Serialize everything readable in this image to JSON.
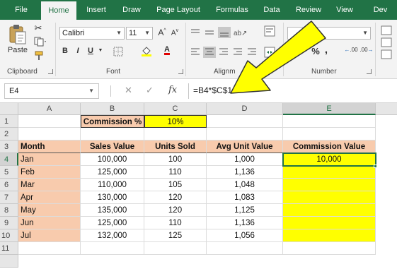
{
  "ribbon": {
    "tabs": [
      {
        "label": "File",
        "active": false
      },
      {
        "label": "Home",
        "active": true
      },
      {
        "label": "Insert",
        "active": false
      },
      {
        "label": "Draw",
        "active": false
      },
      {
        "label": "Page Layout",
        "active": false
      },
      {
        "label": "Formulas",
        "active": false
      },
      {
        "label": "Data",
        "active": false
      },
      {
        "label": "Review",
        "active": false
      },
      {
        "label": "View",
        "active": false
      },
      {
        "label": "Dev",
        "active": false
      }
    ],
    "clipboard": {
      "paste_label": "Paste",
      "group_label": "Clipboard"
    },
    "font": {
      "name": "Calibri",
      "size": "11",
      "bold": "B",
      "italic": "I",
      "underline": "U",
      "grow": "A",
      "shrink": "A",
      "font_color": "A",
      "group_label": "Font"
    },
    "alignment": {
      "group_label": "Alignm"
    },
    "number": {
      "percent": "%",
      "comma": ",",
      "inc_decimal": ".00",
      "dec_decimal": ".00",
      "group_label": "Number"
    }
  },
  "formula_bar": {
    "name_box": "E4",
    "cancel": "✕",
    "enter": "✓",
    "fx": "fx",
    "formula": "=B4*$C$1"
  },
  "sheet": {
    "columns": [
      "A",
      "B",
      "C",
      "D",
      "E"
    ],
    "rows": [
      "1",
      "2",
      "3",
      "4",
      "5",
      "6",
      "7",
      "8",
      "9",
      "10",
      "11"
    ],
    "commission_label": "Commission %",
    "commission_rate": "10%",
    "headers": {
      "month": "Month",
      "sales": "Sales Value",
      "units": "Units Sold",
      "avg": "Avg Unit Value",
      "commission": "Commission Value"
    },
    "data": [
      {
        "month": "Jan",
        "sales": "100,000",
        "units": "100",
        "avg": "1,000",
        "commission": "10,000"
      },
      {
        "month": "Feb",
        "sales": "125,000",
        "units": "110",
        "avg": "1,136",
        "commission": ""
      },
      {
        "month": "Mar",
        "sales": "110,000",
        "units": "105",
        "avg": "1,048",
        "commission": ""
      },
      {
        "month": "Apr",
        "sales": "130,000",
        "units": "120",
        "avg": "1,083",
        "commission": ""
      },
      {
        "month": "May",
        "sales": "135,000",
        "units": "120",
        "avg": "1,125",
        "commission": ""
      },
      {
        "month": "Jun",
        "sales": "125,000",
        "units": "110",
        "avg": "1,136",
        "commission": ""
      },
      {
        "month": "Jul",
        "sales": "132,000",
        "units": "125",
        "avg": "1,056",
        "commission": ""
      }
    ]
  },
  "colors": {
    "accent": "#217346",
    "peach": "#f8cbad",
    "highlight": "#ffff00"
  }
}
